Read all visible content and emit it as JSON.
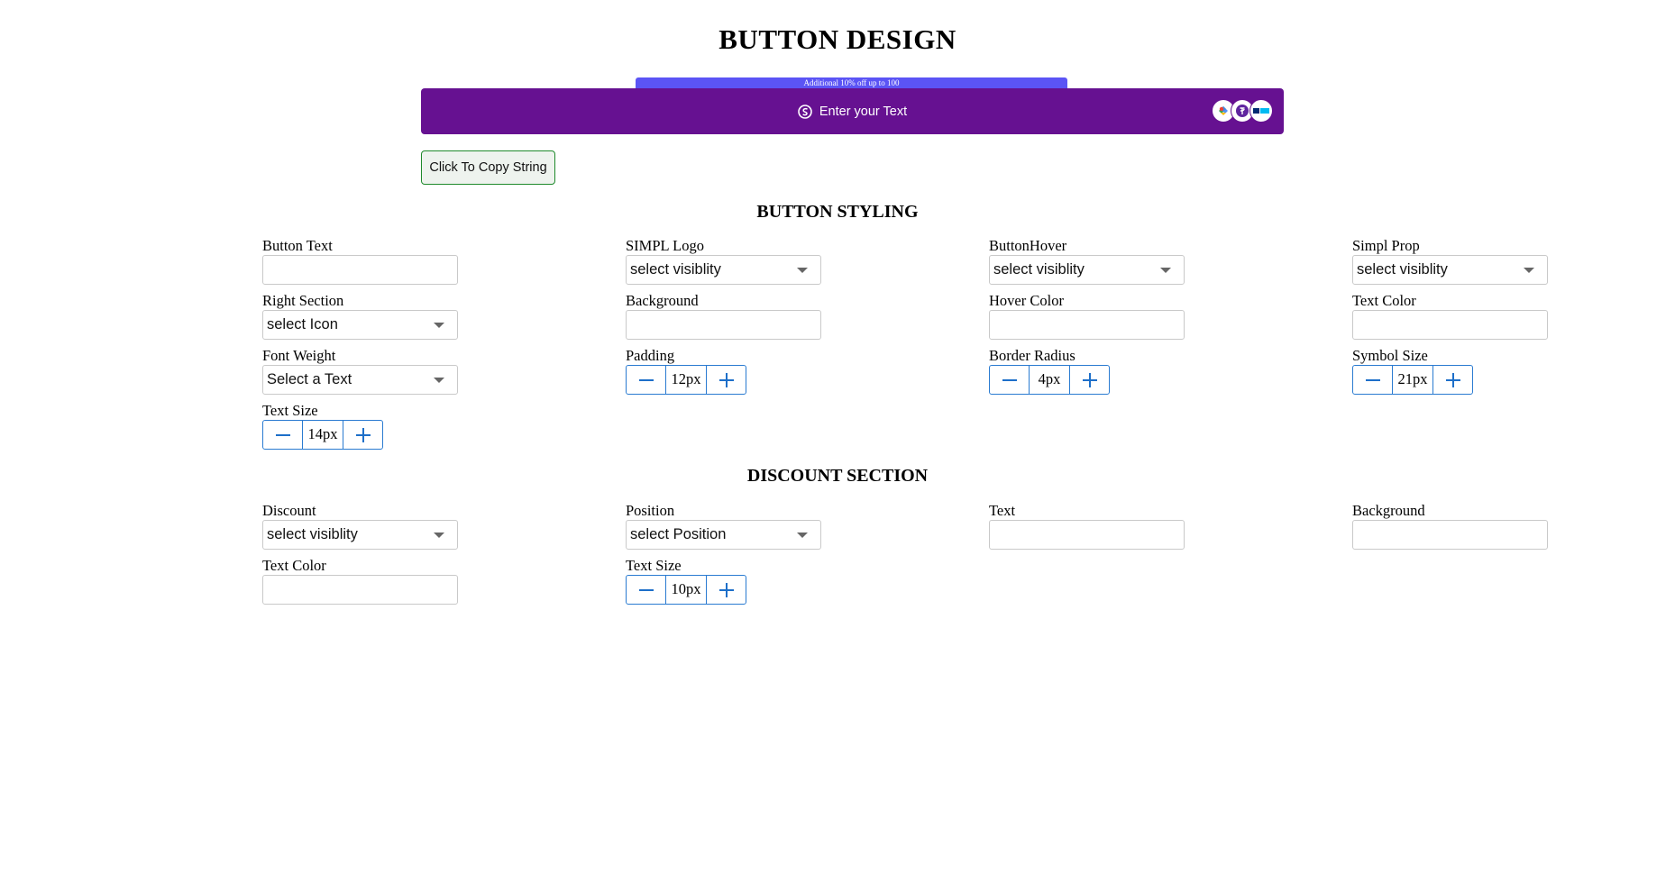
{
  "page": {
    "title": "BUTTON DESIGN"
  },
  "preview": {
    "discount_text": "Additional 10% off up to 100",
    "button_text": "Enter your Text",
    "background": "#661191",
    "discount_background": "#5b54f5",
    "text_color": "#ffffff",
    "icons": [
      "simpl-logo-icon",
      "gpay-icon",
      "phonepe-icon",
      "paytm-icon"
    ]
  },
  "copy_button": {
    "label": "Click To Copy String"
  },
  "button_styling": {
    "title": "BUTTON STYLING",
    "button_text": {
      "label": "Button Text",
      "value": ""
    },
    "simpl_logo": {
      "label": "SIMPL Logo",
      "value": "select visiblity"
    },
    "button_hover": {
      "label": "ButtonHover",
      "value": "select visiblity"
    },
    "simpl_prop": {
      "label": "Simpl Prop",
      "value": "select visiblity"
    },
    "right_section": {
      "label": "Right Section",
      "value": "select Icon"
    },
    "background": {
      "label": "Background",
      "value": ""
    },
    "hover_color": {
      "label": "Hover Color",
      "value": ""
    },
    "text_color": {
      "label": "Text Color",
      "value": ""
    },
    "font_weight": {
      "label": "Font Weight",
      "value": "Select a Text"
    },
    "padding": {
      "label": "Padding",
      "value": "12px"
    },
    "border_radius": {
      "label": "Border Radius",
      "value": "4px"
    },
    "symbol_size": {
      "label": "Symbol Size",
      "value": "21px"
    },
    "text_size": {
      "label": "Text Size",
      "value": "14px"
    }
  },
  "discount_section": {
    "title": "DISCOUNT SECTION",
    "discount": {
      "label": "Discount",
      "value": "select visiblity"
    },
    "position": {
      "label": "Position",
      "value": "select Position"
    },
    "text": {
      "label": "Text",
      "value": ""
    },
    "background": {
      "label": "Background",
      "value": ""
    },
    "text_color": {
      "label": "Text Color",
      "value": ""
    },
    "text_size": {
      "label": "Text Size",
      "value": "10px"
    }
  },
  "colors": {
    "stepper_accent": "#1d6fc9",
    "copy_border": "#1f8a2c"
  }
}
